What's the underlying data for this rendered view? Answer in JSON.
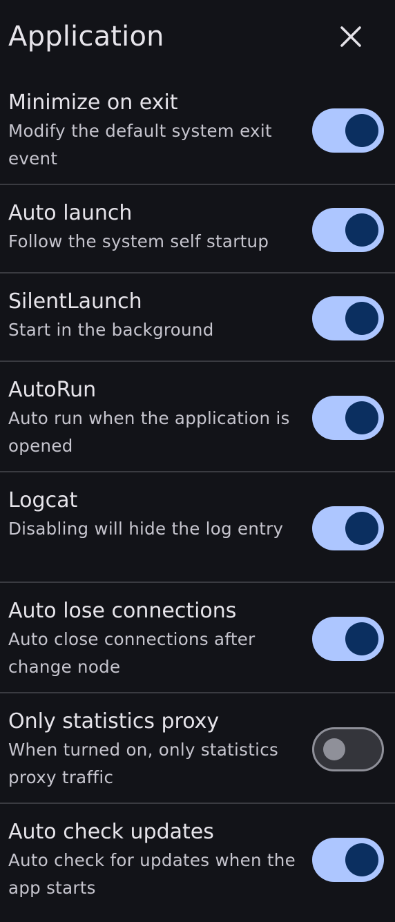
{
  "header": {
    "title": "Application",
    "close_icon": "close-icon"
  },
  "colors": {
    "background": "#121318",
    "switch_on_track": "#adc6ff",
    "switch_on_thumb": "#0b2f60",
    "switch_off_track": "#34353b",
    "switch_off_outline": "#8f9099",
    "divider": "#3a3b41"
  },
  "settings": [
    {
      "title": "Minimize on exit",
      "subtitle": "Modify the default system exit event",
      "enabled": true
    },
    {
      "title": "Auto launch",
      "subtitle": "Follow the system self startup",
      "enabled": true
    },
    {
      "title": "SilentLaunch",
      "subtitle": "Start in the background",
      "enabled": true
    },
    {
      "title": "AutoRun",
      "subtitle": "Auto run when the application is opened",
      "enabled": true
    },
    {
      "title": "Logcat",
      "subtitle": "Disabling will hide the log entry",
      "enabled": true
    },
    {
      "title": "Auto lose connections",
      "subtitle": "Auto close connections after change node",
      "enabled": true
    },
    {
      "title": "Only statistics proxy",
      "subtitle": "When turned on, only statistics proxy traffic",
      "enabled": false
    },
    {
      "title": "Auto check updates",
      "subtitle": "Auto check for updates when the app starts",
      "enabled": true
    }
  ]
}
